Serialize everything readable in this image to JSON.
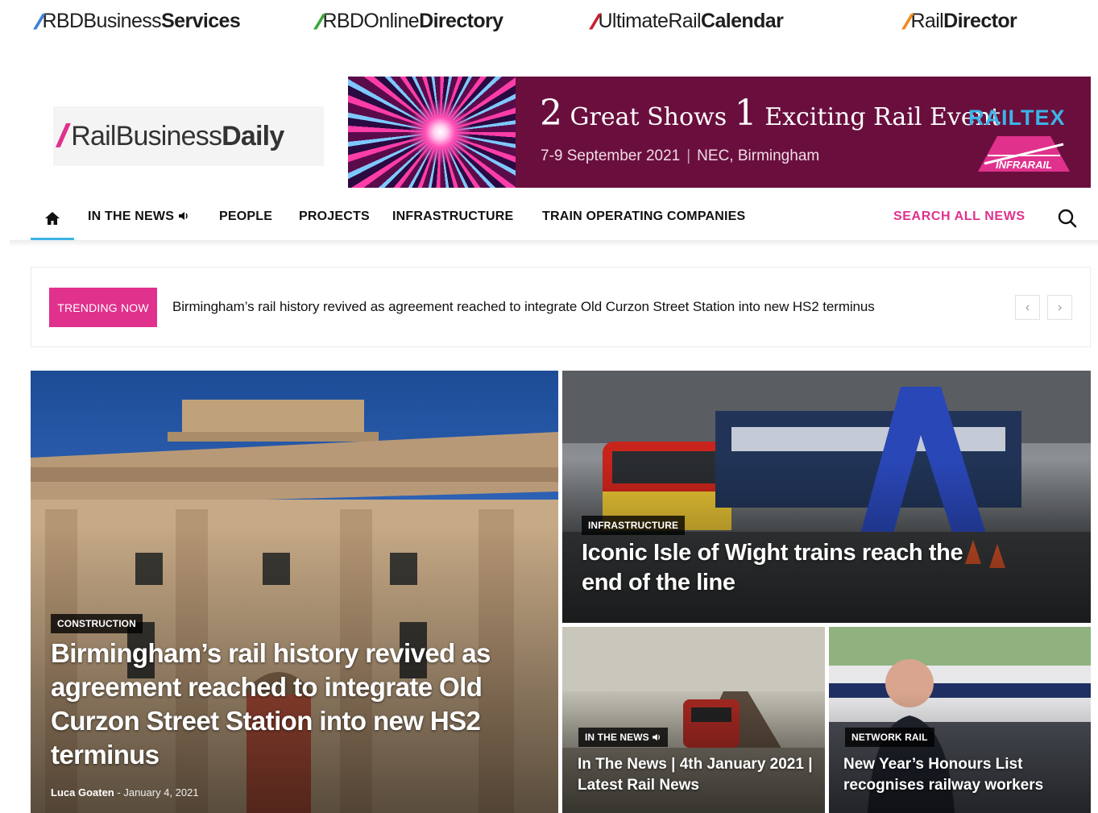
{
  "partners": [
    {
      "light": "RBDBusiness",
      "bold": "Services",
      "color": "#3c7fd4"
    },
    {
      "light": "RBDOnline",
      "bold": "Directory",
      "color": "#3aa639"
    },
    {
      "light": "UltimateRail",
      "bold": "Calendar",
      "color": "#c91f2e"
    },
    {
      "light": "Rail",
      "bold": "Director",
      "color": "#f08a1d"
    }
  ],
  "logo": {
    "light": "RailBusiness",
    "bold": "Daily",
    "color": "#e0318d"
  },
  "banner": {
    "num1": "2",
    "text1": "Great Shows",
    "num2": "1",
    "text2": "Exciting Rail Event",
    "dates": "7-9 September 2021",
    "separator": "|",
    "venue": "NEC, Birmingham",
    "brand": "RAILTEX",
    "brand2": "INFRARAIL",
    "bg_color": "#6a0f3d"
  },
  "nav": {
    "items": [
      "IN THE NEWS",
      "PEOPLE",
      "PROJECTS",
      "INFRASTRUCTURE",
      "TRAIN OPERATING COMPANIES"
    ],
    "search_all": "SEARCH ALL NEWS",
    "accent_color": "#e0318d",
    "active_underline_color": "#3cb4e6",
    "icons": [
      "home-icon",
      "speaker-icon",
      "search-icon"
    ]
  },
  "trending": {
    "badge": "TRENDING NOW",
    "headline": "Birmingham’s rail history revived as agreement reached to integrate Old Curzon Street Station into new HS2 terminus",
    "prev": "‹",
    "next": "›"
  },
  "cards": {
    "main": {
      "category": "CONSTRUCTION",
      "title": "Birmingham’s rail history revived as agreement reached to integrate Old Curzon Street Station into new HS2 terminus",
      "author": "Luca Goaten",
      "separator": "-",
      "date": "January 4, 2021"
    },
    "iow": {
      "category": "INFRASTRUCTURE",
      "title": "Iconic Isle of Wight trains reach the end of the line"
    },
    "news": {
      "category": "IN THE NEWS",
      "title": "In The News | 4th January 2021 | Latest Rail News"
    },
    "honours": {
      "category": "NETWORK RAIL",
      "title": "New Year’s Honours List recognises railway workers"
    }
  }
}
